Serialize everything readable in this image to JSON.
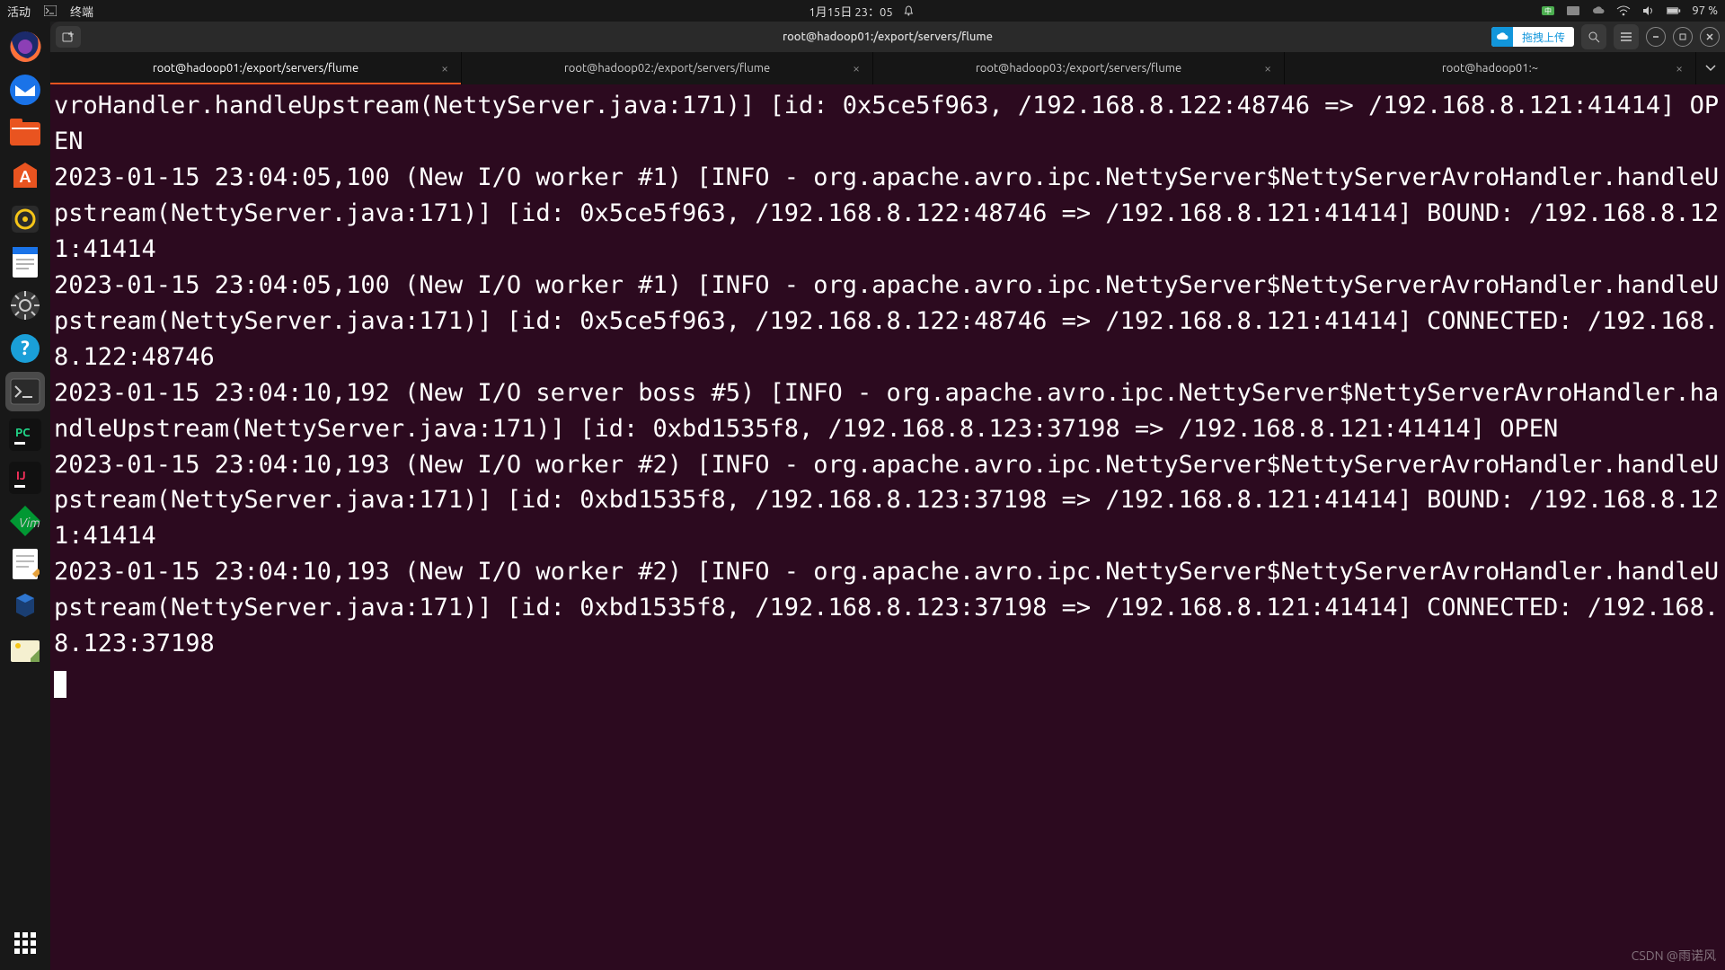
{
  "topbar": {
    "activities": "活动",
    "app_label": "终端",
    "datetime": "1月15日 23：05",
    "battery": "97 %"
  },
  "titlebar": {
    "title": "root@hadoop01:/export/servers/flume",
    "upload_label": "拖拽上传"
  },
  "tabs": [
    {
      "label": "root@hadoop01:/export/servers/flume",
      "active": true
    },
    {
      "label": "root@hadoop02:/export/servers/flume",
      "active": false
    },
    {
      "label": "root@hadoop03:/export/servers/flume",
      "active": false
    },
    {
      "label": "root@hadoop01:~",
      "active": false
    }
  ],
  "terminal_text": "vroHandler.handleUpstream(NettyServer.java:171)] [id: 0x5ce5f963, /192.168.8.122:48746 => /192.168.8.121:41414] OPEN\n2023-01-15 23:04:05,100 (New I/O worker #1) [INFO - org.apache.avro.ipc.NettyServer$NettyServerAvroHandler.handleUpstream(NettyServer.java:171)] [id: 0x5ce5f963, /192.168.8.122:48746 => /192.168.8.121:41414] BOUND: /192.168.8.121:41414\n2023-01-15 23:04:05,100 (New I/O worker #1) [INFO - org.apache.avro.ipc.NettyServer$NettyServerAvroHandler.handleUpstream(NettyServer.java:171)] [id: 0x5ce5f963, /192.168.8.122:48746 => /192.168.8.121:41414] CONNECTED: /192.168.8.122:48746\n2023-01-15 23:04:10,192 (New I/O server boss #5) [INFO - org.apache.avro.ipc.NettyServer$NettyServerAvroHandler.handleUpstream(NettyServer.java:171)] [id: 0xbd1535f8, /192.168.8.123:37198 => /192.168.8.121:41414] OPEN\n2023-01-15 23:04:10,193 (New I/O worker #2) [INFO - org.apache.avro.ipc.NettyServer$NettyServerAvroHandler.handleUpstream(NettyServer.java:171)] [id: 0xbd1535f8, /192.168.8.123:37198 => /192.168.8.121:41414] BOUND: /192.168.8.121:41414\n2023-01-15 23:04:10,193 (New I/O worker #2) [INFO - org.apache.avro.ipc.NettyServer$NettyServerAvroHandler.handleUpstream(NettyServer.java:171)] [id: 0xbd1535f8, /192.168.8.123:37198 => /192.168.8.121:41414] CONNECTED: /192.168.8.123:37198\n",
  "watermark": "CSDN @雨诺风",
  "dock_icons": [
    "firefox",
    "thunderbird",
    "files",
    "software",
    "rhythmbox",
    "writer",
    "settings",
    "help",
    "terminal",
    "pycharm",
    "intellij",
    "vim",
    "gedit",
    "virtualbox",
    "screenshot"
  ]
}
